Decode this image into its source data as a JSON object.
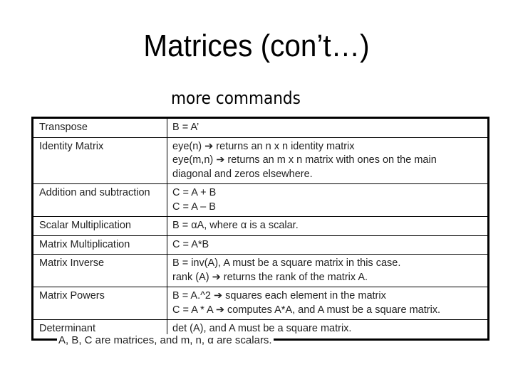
{
  "slide": {
    "title": "Matrices (con’t…)",
    "subtitle": "more commands",
    "rows": [
      {
        "label": "Transpose",
        "lines": [
          "B = A’"
        ]
      },
      {
        "label": "Identity Matrix",
        "lines": [
          "eye(n)  ➔ returns an n x n identity matrix",
          "eye(m,n) ➔ returns an m x n matrix with ones on the main",
          "diagonal and zeros elsewhere."
        ]
      },
      {
        "label": "Addition and subtraction",
        "lines": [
          "C = A + B",
          "C = A – B"
        ]
      },
      {
        "label": "Scalar Multiplication",
        "lines": [
          "B = αA, where α is a scalar."
        ]
      },
      {
        "label": "Matrix Multiplication",
        "lines": [
          "C = A*B"
        ]
      },
      {
        "label": "Matrix Inverse",
        "lines": [
          "B = inv(A), A must be a square matrix in this case.",
          "rank (A) ➔ returns the rank of the matrix A."
        ]
      },
      {
        "label": "Matrix Powers",
        "lines": [
          "B = A.^2  ➔ squares each element in the matrix",
          "C = A * A ➔ computes A*A, and A must be a square matrix."
        ]
      },
      {
        "label": "Determinant",
        "lines": [
          "det (A), and A must be a square matrix."
        ]
      }
    ],
    "footnote": "A, B, C are matrices, and m, n, α are scalars."
  }
}
